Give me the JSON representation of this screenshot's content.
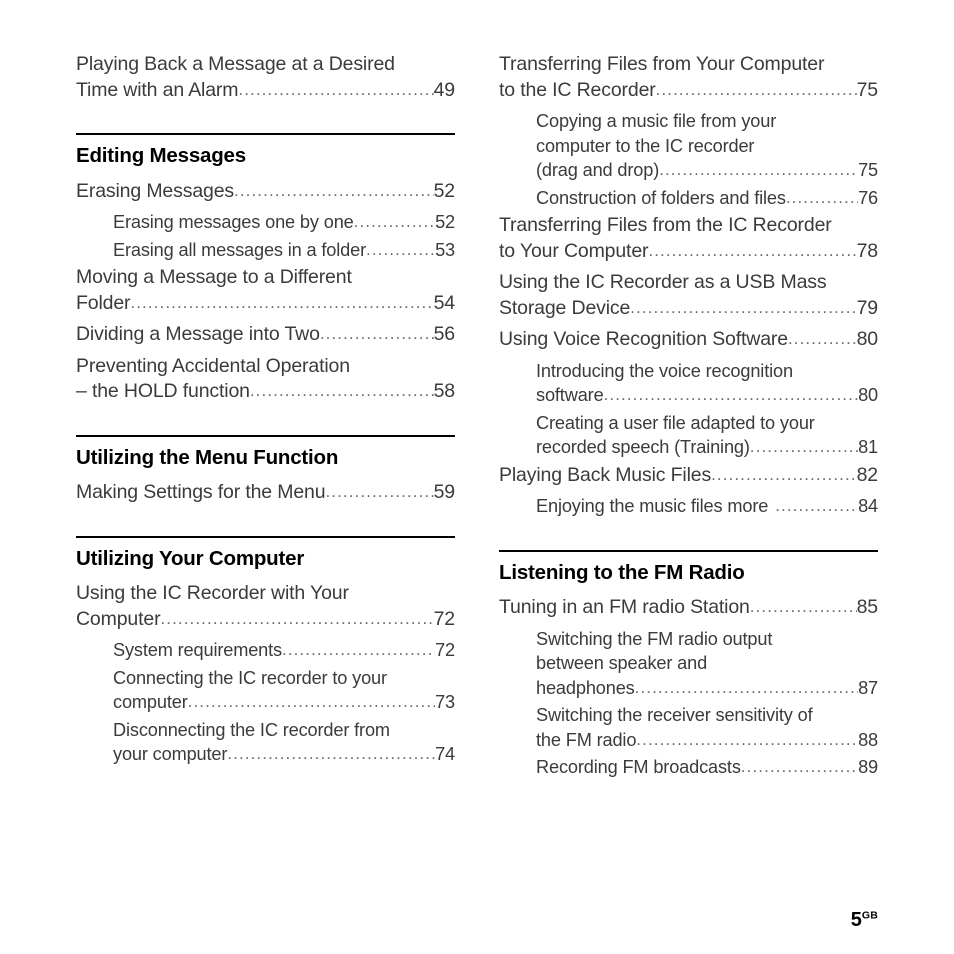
{
  "document": {
    "type": "table-of-contents",
    "folio_number": "5",
    "folio_suffix": "GB"
  },
  "left_column": [
    {
      "kind": "entry",
      "level": "main",
      "lines": [
        "Playing Back a Message at a Desired",
        "Time with an Alarm"
      ],
      "page": "49"
    },
    {
      "kind": "section",
      "heading": "Editing Messages",
      "entries": [
        {
          "level": "main",
          "lines": [
            "Erasing Messages"
          ],
          "page": "52"
        },
        {
          "level": "sub",
          "lines": [
            "Erasing messages one by one"
          ],
          "page": "52"
        },
        {
          "level": "sub",
          "lines": [
            "Erasing all messages in a folder"
          ],
          "page": "53"
        },
        {
          "level": "main",
          "lines": [
            "Moving a Message to a Different",
            "Folder"
          ],
          "page": "54"
        },
        {
          "level": "main",
          "lines": [
            "Dividing a Message into Two"
          ],
          "page": "56"
        },
        {
          "level": "main",
          "lines": [
            "Preventing Accidental Operation",
            "– the HOLD function"
          ],
          "page": "58"
        }
      ]
    },
    {
      "kind": "section",
      "heading": "Utilizing the Menu Function",
      "entries": [
        {
          "level": "main",
          "lines": [
            "Making Settings for the Menu"
          ],
          "page": "59"
        }
      ]
    },
    {
      "kind": "section",
      "heading": "Utilizing Your Computer",
      "entries": [
        {
          "level": "main",
          "lines": [
            "Using the IC Recorder with Your",
            "Computer"
          ],
          "page": "72"
        },
        {
          "level": "sub",
          "lines": [
            "System requirements"
          ],
          "page": "72"
        },
        {
          "level": "sub",
          "lines": [
            "Connecting the IC recorder to your",
            "computer"
          ],
          "page": "73"
        },
        {
          "level": "sub",
          "lines": [
            "Disconnecting the IC recorder from",
            "your computer"
          ],
          "page": "74"
        }
      ]
    }
  ],
  "right_column": [
    {
      "kind": "entry",
      "level": "main",
      "lines": [
        "Transferring Files from Your Computer",
        "to the IC Recorder"
      ],
      "page": "75"
    },
    {
      "kind": "entry",
      "level": "sub",
      "lines": [
        "Copying a music file from your",
        "computer to the IC recorder",
        "(drag and drop)"
      ],
      "page": "75"
    },
    {
      "kind": "entry",
      "level": "sub",
      "lines": [
        "Construction of folders and files"
      ],
      "page": "76"
    },
    {
      "kind": "entry",
      "level": "main",
      "lines": [
        "Transferring Files from the IC Recorder",
        "to Your Computer"
      ],
      "page": "78"
    },
    {
      "kind": "entry",
      "level": "main",
      "lines": [
        "Using the IC Recorder as a USB Mass",
        "Storage Device"
      ],
      "page": "79"
    },
    {
      "kind": "entry",
      "level": "main",
      "lines": [
        "Using Voice Recognition Software"
      ],
      "page": "80"
    },
    {
      "kind": "entry",
      "level": "sub",
      "lines": [
        "Introducing the voice recognition",
        "software"
      ],
      "page": "80"
    },
    {
      "kind": "entry",
      "level": "sub",
      "lines": [
        "Creating a user file adapted to your",
        "recorded speech (Training)"
      ],
      "page": "81"
    },
    {
      "kind": "entry",
      "level": "main",
      "lines": [
        "Playing Back Music Files"
      ],
      "page": "82"
    },
    {
      "kind": "entry",
      "level": "sub",
      "lines": [
        "Enjoying the music files more"
      ],
      "page": "84",
      "extra_gap": true
    },
    {
      "kind": "section",
      "heading": "Listening to the FM Radio",
      "entries": [
        {
          "level": "main",
          "lines": [
            "Tuning in an FM radio Station"
          ],
          "page": "85"
        },
        {
          "level": "sub",
          "lines": [
            "Switching the FM radio output",
            "between speaker and",
            "headphones"
          ],
          "page": "87"
        },
        {
          "level": "sub",
          "lines": [
            "Switching the receiver sensitivity of",
            "the FM radio"
          ],
          "page": "88"
        },
        {
          "level": "sub",
          "lines": [
            "Recording FM broadcasts"
          ],
          "page": "89"
        }
      ]
    }
  ]
}
